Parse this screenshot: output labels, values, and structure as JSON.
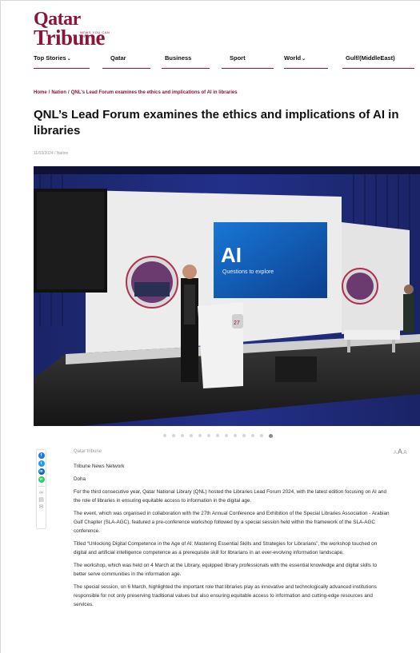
{
  "brand": {
    "name_top": "Qatar",
    "name_bottom": "Tribune",
    "tagline": "NEWS YOU CAN TRUST",
    "color": "#8a1538"
  },
  "nav": {
    "items": [
      {
        "label": "Top Stories",
        "dropdown": true
      },
      {
        "label": "Qatar",
        "dropdown": false
      },
      {
        "label": "Business",
        "dropdown": false
      },
      {
        "label": "Sport",
        "dropdown": false
      },
      {
        "label": "World",
        "dropdown": true
      },
      {
        "label": "Gulf/(MiddleEast)",
        "dropdown": false
      }
    ]
  },
  "breadcrumb": {
    "home": "Home",
    "section": "Nation",
    "current": "QNL's Lead Forum examines the ethics and implications of AI in libraries",
    "separator": "/"
  },
  "article": {
    "headline": "QNL’s Lead Forum examines the ethics and implications of AI in libraries",
    "meta": "11/03/2024 / Nation",
    "hero_screen_title": "AI",
    "hero_screen_subtitle": "Questions to explore",
    "hero_podium_badge": "27",
    "byline": "Qatar tribune",
    "source": "Tribune News Network",
    "dateline": "Doha",
    "paragraphs": [
      "For the third consecutive year, Qatar National Library (QNL) hosted the Libraries Lead Forum 2024, with the latest edition focusing on AI and the role of libraries in ensuring equitable access to information in the digital age.",
      "The event, which was organised in collaboration with the 27th Annual Conference and Exhibition of the Special Libraries Association - Arabian Gulf Chapter (SLA-AGC), featured a pre-conference workshop followed by a special session held within the framework of the SLA-AGC conference.",
      "Titled “Unlocking Digital Competence in the Age of AI: Mastering Essential Skills and Strategies for Librarians”, the workshop touched on digital and artificial intelligence competence as a prerequisite skill for librarians in an ever-evolving information landscape.",
      "The workshop, which was held on 4 March at the Library, equipped library professionals with the essential knowledge and digital skills to better serve communities in the information age.",
      "The special session, on 6 March, highlighted the important role that libraries play as innovative and technologically advanced institutions responsible for not only preserving traditional values but also ensuring equitable access to information and cutting-edge resources and services."
    ]
  },
  "carousel": {
    "dot_count": 13,
    "active_index": 12
  },
  "share": {
    "icons": [
      "facebook-icon",
      "twitter-icon",
      "linkedin-icon",
      "whatsapp-icon",
      "link-icon",
      "print-icon",
      "email-icon"
    ]
  },
  "font_controls": {
    "small": "A",
    "medium": "A",
    "large": "A"
  }
}
